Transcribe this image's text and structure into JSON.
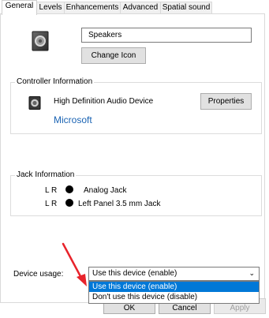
{
  "tabs": [
    "General",
    "Levels",
    "Enhancements",
    "Advanced",
    "Spatial sound"
  ],
  "device_name": "Speakers",
  "change_icon_label": "Change Icon",
  "controller": {
    "title": "Controller Information",
    "device": "High Definition Audio Device",
    "vendor": "Microsoft",
    "properties_label": "Properties"
  },
  "jack": {
    "title": "Jack Information",
    "rows": [
      {
        "lr": "L R",
        "label": "Analog Jack"
      },
      {
        "lr": "L R",
        "label": "Left Panel 3.5 mm Jack"
      }
    ]
  },
  "device_usage": {
    "label": "Device usage:",
    "selected": "Use this device (enable)",
    "options": [
      "Use this device (enable)",
      "Don't use this device (disable)"
    ]
  },
  "buttons": {
    "ok": "OK",
    "cancel": "Cancel",
    "apply": "Apply"
  },
  "colors": {
    "accent": "#0078d7",
    "arrow": "#e8232b",
    "link": "#1a63b3"
  }
}
